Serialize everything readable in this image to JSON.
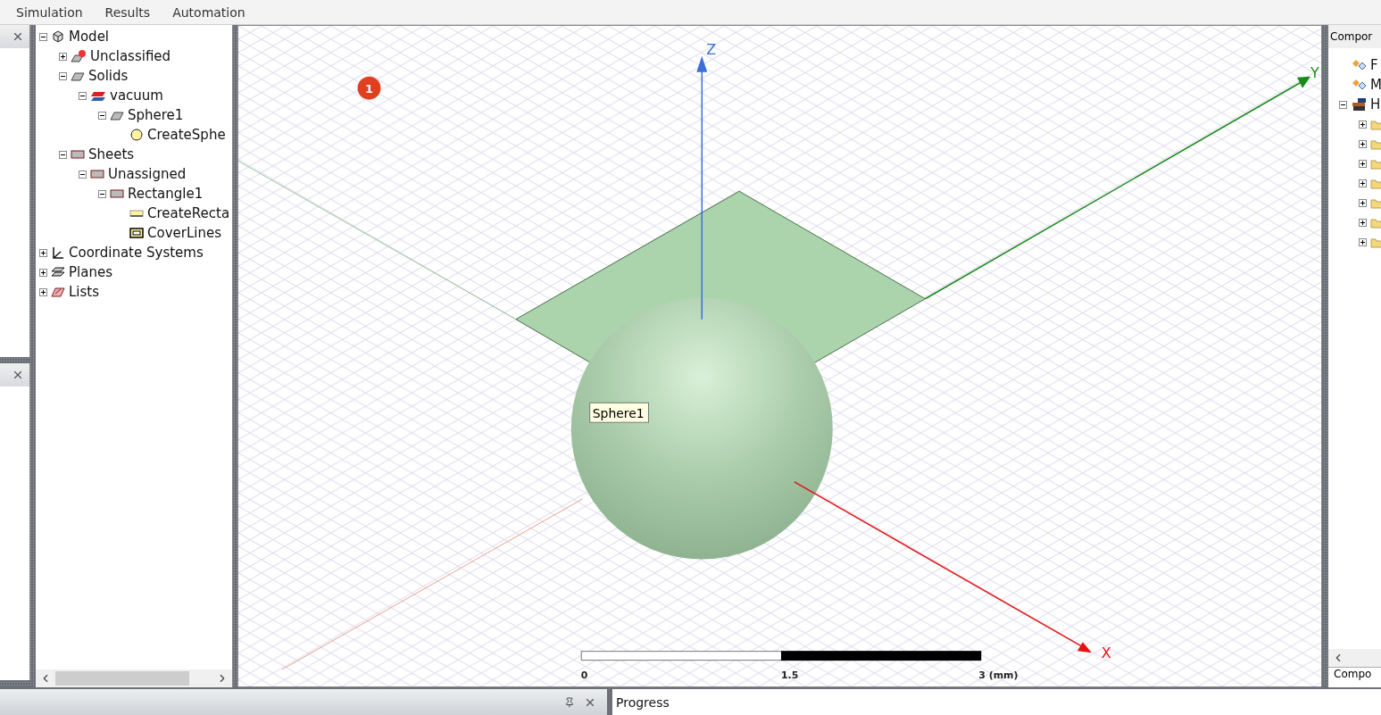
{
  "menu": [
    {
      "label": "Simulation"
    },
    {
      "label": "Results"
    },
    {
      "label": "Automation"
    }
  ],
  "model_tree": [
    {
      "label": "Model",
      "kind": "model",
      "expanded": true,
      "children": [
        {
          "label": "Unclassified",
          "kind": "unclassified",
          "expanded": false
        },
        {
          "label": "Solids",
          "kind": "solid",
          "expanded": true,
          "children": [
            {
              "label": "vacuum",
              "kind": "material",
              "expanded": true,
              "children": [
                {
                  "label": "Sphere1",
                  "kind": "solid",
                  "expanded": true,
                  "children": [
                    {
                      "label": "CreateSphe",
                      "kind": "sphere-op"
                    }
                  ]
                }
              ]
            }
          ]
        },
        {
          "label": "Sheets",
          "kind": "sheet",
          "expanded": true,
          "children": [
            {
              "label": "Unassigned",
              "kind": "sheet",
              "expanded": true,
              "children": [
                {
                  "label": "Rectangle1",
                  "kind": "sheet",
                  "expanded": true,
                  "children": [
                    {
                      "label": "CreateRecta",
                      "kind": "rect-op"
                    },
                    {
                      "label": "CoverLines",
                      "kind": "cover-op"
                    }
                  ]
                }
              ]
            }
          ]
        }
      ]
    },
    {
      "label": "Coordinate Systems",
      "kind": "coords",
      "expanded": false
    },
    {
      "label": "Planes",
      "kind": "planes",
      "expanded": false
    },
    {
      "label": "Lists",
      "kind": "lists",
      "expanded": false
    }
  ],
  "viewport": {
    "axes": [
      {
        "kind": "z",
        "label": "Z"
      },
      {
        "kind": "y",
        "label": "Y"
      },
      {
        "kind": "x",
        "label": "X"
      }
    ],
    "badge": "1",
    "tooltip": "Sphere1",
    "scale_labels": [
      "0",
      "1.5",
      "3 (mm)"
    ]
  },
  "components_panel": {
    "title": "Compor",
    "items": [
      {
        "label": "F",
        "kind": "link"
      },
      {
        "label": "M",
        "kind": "link"
      },
      {
        "label": "H",
        "kind": "library",
        "expanded": true,
        "children": [
          {
            "kind": "folder",
            "expanded": false
          },
          {
            "kind": "folder",
            "expanded": false
          },
          {
            "kind": "folder",
            "expanded": false
          },
          {
            "kind": "folder",
            "expanded": false
          },
          {
            "kind": "folder",
            "expanded": false
          },
          {
            "kind": "folder",
            "expanded": false
          },
          {
            "kind": "folder",
            "expanded": false
          }
        ]
      }
    ],
    "tab": "Compo"
  },
  "bottom": {
    "progress_title": "Progress"
  }
}
